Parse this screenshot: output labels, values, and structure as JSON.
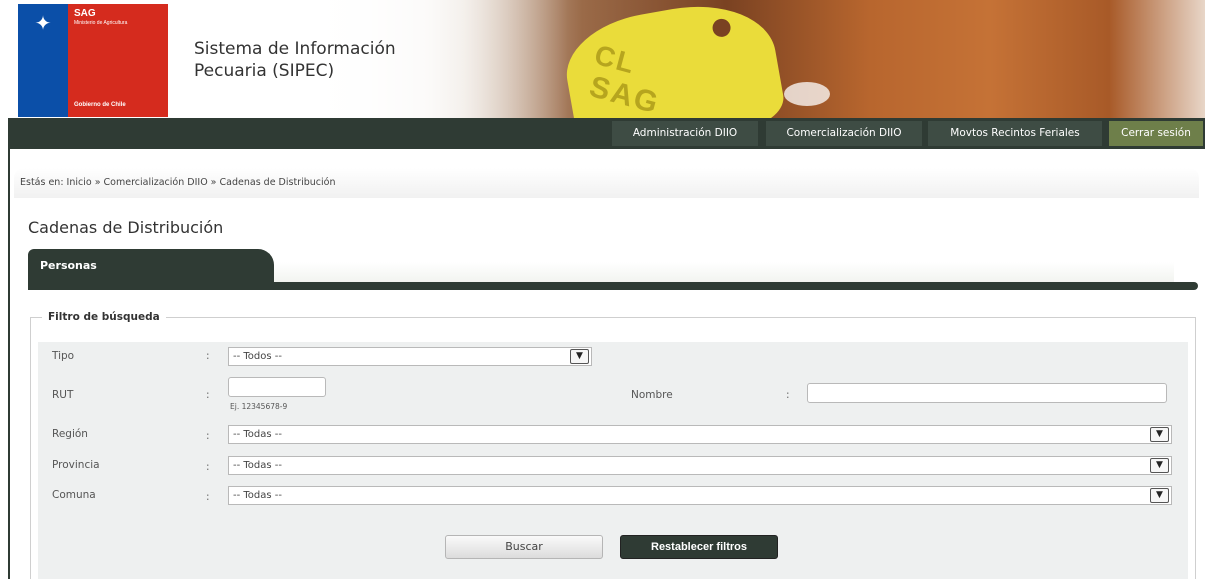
{
  "header": {
    "logo": {
      "sag": "SAG",
      "ministry": "Ministerio de Agricultura",
      "government": "Gobierno de Chile"
    },
    "title_line1": "Sistema de Información",
    "title_line2": "Pecuaria (SIPEC)",
    "tag_text_1": "CL",
    "tag_text_2": "SAG"
  },
  "nav": {
    "items": [
      {
        "label": "Administración DIIO"
      },
      {
        "label": "Comercialización DIIO"
      },
      {
        "label": "Movtos Recintos Feriales"
      },
      {
        "label": "Cerrar sesión"
      }
    ]
  },
  "breadcrumb": "Estás en: Inicio » Comercialización DIIO » Cadenas de Distribución",
  "page_title": "Cadenas de Distribución",
  "tab": {
    "label": "Personas"
  },
  "filter": {
    "legend": "Filtro de búsqueda",
    "colon": ":",
    "tipo": {
      "label": "Tipo",
      "value": "-- Todos --"
    },
    "rut": {
      "label": "RUT",
      "value": "",
      "hint": "Ej. 12345678-9"
    },
    "nombre": {
      "label": "Nombre",
      "value": ""
    },
    "region": {
      "label": "Región",
      "value": "-- Todas --"
    },
    "provincia": {
      "label": "Provincia",
      "value": "-- Todas --"
    },
    "comuna": {
      "label": "Comuna",
      "value": "-- Todas --"
    },
    "dropdown_icon": "chevron-down-icon"
  },
  "buttons": {
    "search": "Buscar",
    "reset": "Restablecer filtros"
  },
  "colors": {
    "dark_green": "#2f3b34",
    "logout_green": "#6e7f4a",
    "chile_red": "#d52b1e",
    "chile_blue": "#0b4fa8"
  }
}
